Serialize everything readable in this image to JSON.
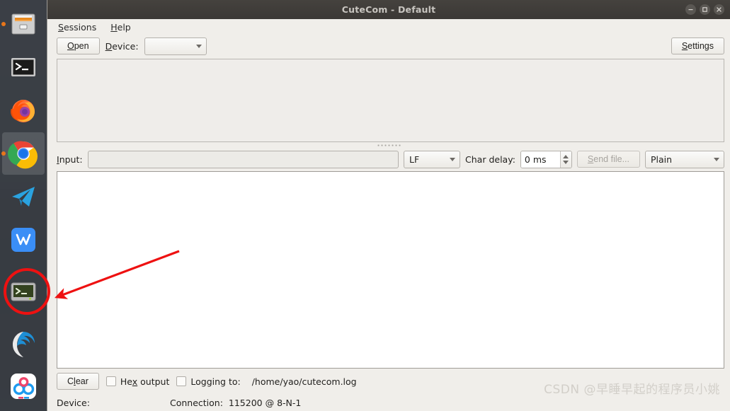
{
  "window": {
    "title": "CuteCom - Default",
    "controls": [
      {
        "name": "minimize",
        "glyph": "–"
      },
      {
        "name": "maximize",
        "glyph": "□"
      },
      {
        "name": "close",
        "glyph": "×"
      }
    ]
  },
  "menubar": {
    "items": [
      {
        "label": "Sessions",
        "mnemonic": "S"
      },
      {
        "label": "Help",
        "mnemonic": "H"
      }
    ]
  },
  "toolbar": {
    "open_label": "Open",
    "open_mnemonic": "O",
    "device_label": "Device:",
    "device_mnemonic": "D",
    "device_value": "",
    "settings_label": "Settings",
    "settings_mnemonic": "S"
  },
  "input_row": {
    "input_label": "Input:",
    "input_mnemonic": "I",
    "input_value": "",
    "input_placeholder": "",
    "line_ending": "LF",
    "char_delay_label": "Char delay:",
    "char_delay_value": "0 ms",
    "send_file_label": "Send file...",
    "send_file_mnemonic": "e",
    "send_file_enabled": false,
    "format": "Plain"
  },
  "bottom_row": {
    "clear_label": "Clear",
    "clear_mnemonic": "l",
    "hex_output_label": "Hex output",
    "hex_output_mnemonic": "x",
    "hex_output_checked": false,
    "logging_label": "Logging to:",
    "logging_checked": false,
    "log_path": "/home/yao/cutecom.log"
  },
  "statusbar": {
    "device_label": "Device:",
    "device_value": "",
    "connection_label": "Connection:",
    "connection_value": "115200 @ 8-N-1"
  },
  "watermark": {
    "text": "CSDN @早睡早起的程序员小姚"
  },
  "launcher": {
    "items": [
      {
        "name": "files-icon",
        "label": "Files"
      },
      {
        "name": "terminal-icon",
        "label": "Terminal"
      },
      {
        "name": "firefox-icon",
        "label": "Firefox"
      },
      {
        "name": "chrome-icon",
        "label": "Google Chrome"
      },
      {
        "name": "telegram-icon",
        "label": "Telegram"
      },
      {
        "name": "wps-office-icon",
        "label": "WPS Office"
      },
      {
        "name": "cutecom-terminal-icon",
        "label": "CuteCom"
      },
      {
        "name": "deepin-icon",
        "label": "Deepin"
      },
      {
        "name": "netease-music-icon",
        "label": "Music"
      }
    ]
  },
  "annotation": {
    "arrow_color": "#ee1111",
    "circle_color": "#ee1111"
  },
  "colors": {
    "titlebar": "#3b3835",
    "window_bg": "#f0eeea",
    "output_bg": "#ffffff",
    "accent_red": "#ee1111"
  }
}
